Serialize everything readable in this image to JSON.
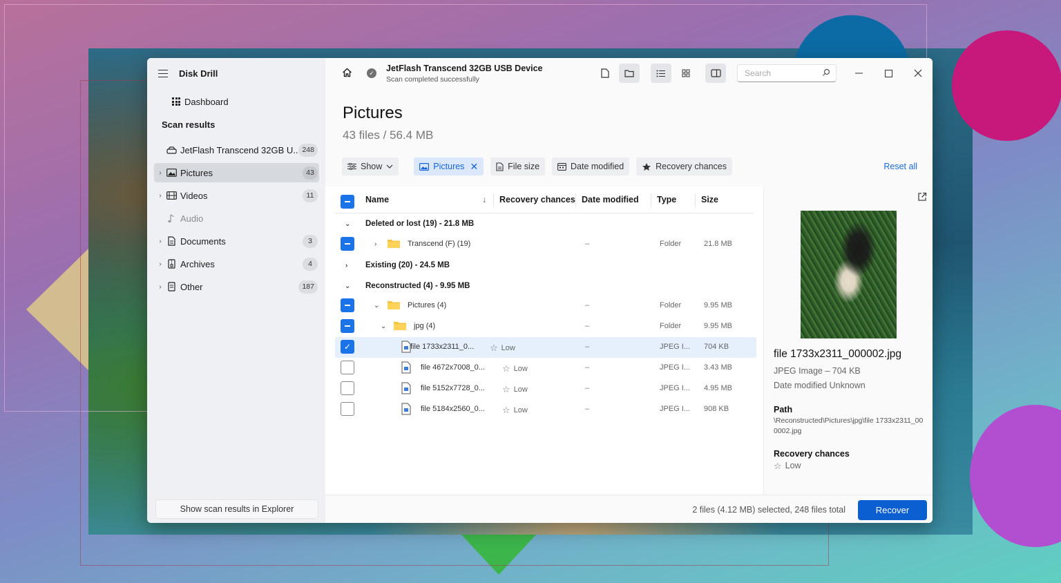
{
  "app": {
    "title": "Disk Drill"
  },
  "sidebar": {
    "dashboard": "Dashboard",
    "section": "Scan results",
    "items": [
      {
        "label": "JetFlash Transcend 32GB U...",
        "count": "248",
        "icon": "drive-icon"
      },
      {
        "label": "Pictures",
        "count": "43",
        "icon": "picture-icon",
        "active": true
      },
      {
        "label": "Videos",
        "count": "11",
        "icon": "film-icon"
      },
      {
        "label": "Audio",
        "count": "",
        "icon": "music-note-icon"
      },
      {
        "label": "Documents",
        "count": "3",
        "icon": "document-icon"
      },
      {
        "label": "Archives",
        "count": "4",
        "icon": "archive-icon"
      },
      {
        "label": "Other",
        "count": "187",
        "icon": "file-icon"
      }
    ],
    "explorer_button": "Show scan results in Explorer"
  },
  "topbar": {
    "device": "JetFlash Transcend 32GB USB Device",
    "status": "Scan completed successfully",
    "search_placeholder": "Search"
  },
  "page": {
    "title": "Pictures",
    "subtitle": "43 files / 56.4 MB"
  },
  "filters": {
    "show": "Show",
    "pictures": "Pictures",
    "file_size": "File size",
    "date_modified": "Date modified",
    "recovery_chances": "Recovery chances",
    "reset_all": "Reset all"
  },
  "table": {
    "headers": {
      "name": "Name",
      "recovery": "Recovery chances",
      "date": "Date modified",
      "type": "Type",
      "size": "Size"
    },
    "rows": [
      {
        "kind": "group",
        "label": "Deleted or lost (19) - 21.8 MB"
      },
      {
        "kind": "folder",
        "name": "Transcend (F) (19)",
        "date": "–",
        "type": "Folder",
        "size": "21.8 MB"
      },
      {
        "kind": "group",
        "label": "Existing (20) - 24.5 MB"
      },
      {
        "kind": "group",
        "label": "Reconstructed (4) - 9.95 MB"
      },
      {
        "kind": "folder",
        "name": "Pictures (4)",
        "date": "–",
        "type": "Folder",
        "size": "9.95 MB"
      },
      {
        "kind": "folder",
        "name": "jpg (4)",
        "date": "–",
        "type": "Folder",
        "size": "9.95 MB"
      },
      {
        "kind": "file",
        "name": "file 1733x2311_0...",
        "recovery": "Low",
        "date": "–",
        "type": "JPEG I...",
        "size": "704 KB"
      },
      {
        "kind": "file",
        "name": "file 4672x7008_0...",
        "recovery": "Low",
        "date": "–",
        "type": "JPEG I...",
        "size": "3.43 MB"
      },
      {
        "kind": "file",
        "name": "file 5152x7728_0...",
        "recovery": "Low",
        "date": "–",
        "type": "JPEG I...",
        "size": "4.95 MB"
      },
      {
        "kind": "file",
        "name": "file 5184x2560_0...",
        "recovery": "Low",
        "date": "–",
        "type": "JPEG I...",
        "size": "908 KB"
      }
    ]
  },
  "preview": {
    "filename": "file 1733x2311_000002.jpg",
    "meta": "JPEG Image – 704 KB",
    "date": "Date modified Unknown",
    "path_label": "Path",
    "path": "\\Reconstructed\\Pictures\\jpg\\file 1733x2311_000002.jpg",
    "recovery_label": "Recovery chances",
    "recovery_value": "Low"
  },
  "footer": {
    "status": "2 files (4.12 MB) selected, 248 files total",
    "recover": "Recover"
  },
  "colors": {
    "accent": "#1a73e8",
    "recover": "#0b5fd0"
  }
}
